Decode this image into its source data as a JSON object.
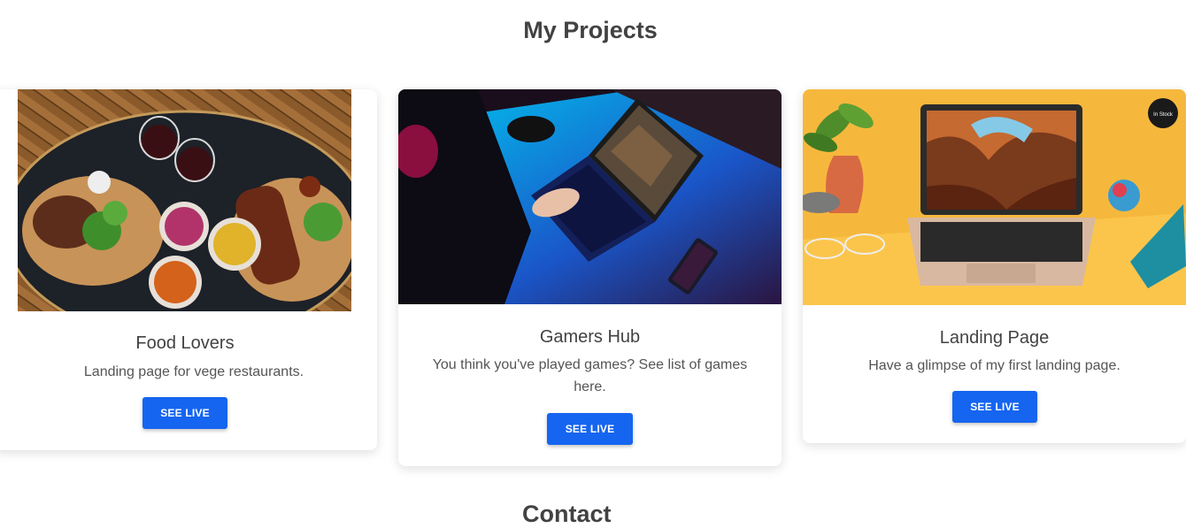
{
  "section": {
    "title": "My Projects",
    "next_title": "Contact"
  },
  "projects": [
    {
      "title": "Food Lovers",
      "description": "Landing page for vege restaurants.",
      "button": "SEE LIVE",
      "image": "food-platter-photo"
    },
    {
      "title": "Gamers Hub",
      "description_line1": "You think you've played games? See list of games",
      "description_line2": "here.",
      "button": "SEE LIVE",
      "image": "gaming-laptop-photo"
    },
    {
      "title": "Landing Page",
      "description": "Have a glimpse of my first landing page.",
      "button": "SEE LIVE",
      "image": "laptop-desk-photo",
      "badge": "In Stock"
    }
  ],
  "colors": {
    "button": "#1565f0",
    "heading": "#424242",
    "text": "#555555"
  }
}
